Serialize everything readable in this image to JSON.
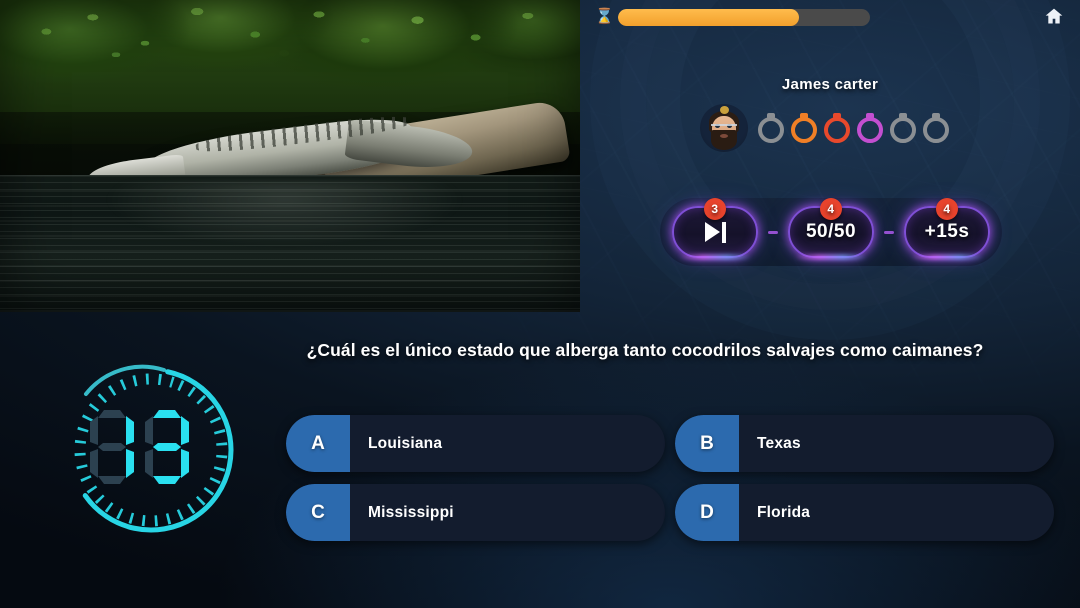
{
  "topbar": {
    "timer_icon": "hourglass-icon",
    "progress_percent": 72,
    "home_icon": "home-icon"
  },
  "player": {
    "name": "James carter",
    "avatar_icon": "avatar-bearded-man-bun",
    "life_rings": [
      {
        "state": "empty",
        "color": "#8b8f93"
      },
      {
        "state": "filled",
        "color": "#f07f26"
      },
      {
        "state": "filled",
        "color": "#e8492c"
      },
      {
        "state": "filled",
        "color": "#c34fd0"
      },
      {
        "state": "empty",
        "color": "#8b8f93"
      },
      {
        "state": "empty",
        "color": "#8b8f93"
      }
    ]
  },
  "powerups": [
    {
      "name": "skip-powerup",
      "label": "",
      "icon": "skip-next-icon",
      "badge": "3"
    },
    {
      "name": "fifty-fifty-powerup",
      "label": "50/50",
      "icon": "",
      "badge": "4"
    },
    {
      "name": "add-time-powerup",
      "label": "+15s",
      "icon": "",
      "badge": "4"
    }
  ],
  "question": {
    "text": "¿Cuál es el único estado que alberga tanto cocodrilos salvajes como caimanes?"
  },
  "countdown": {
    "value": "13",
    "digit_left": "1",
    "digit_right": "3",
    "arc_percent": 62,
    "accent_color": "#2ae0f0"
  },
  "answers": [
    {
      "letter": "A",
      "text": "Louisiana"
    },
    {
      "letter": "B",
      "text": "Texas"
    },
    {
      "letter": "C",
      "text": "Mississippi"
    },
    {
      "letter": "D",
      "text": "Florida"
    }
  ],
  "media": {
    "description": "crocodile-on-log-photo"
  },
  "colors": {
    "progress": "#f2a02c",
    "badge": "#e8432c",
    "answer_letter": "#2c6aae",
    "powerup_border": "#7f4fd6"
  }
}
